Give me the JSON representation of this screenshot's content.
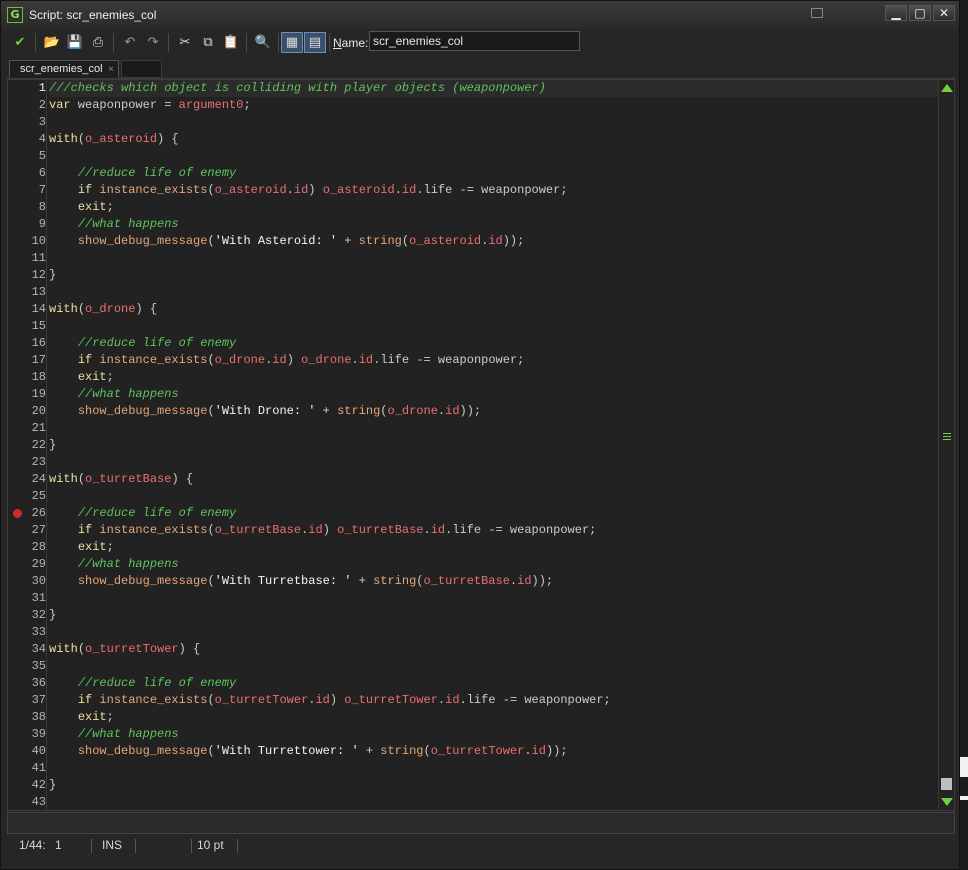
{
  "window": {
    "title": "Script: scr_enemies_col"
  },
  "titlebar": {
    "minimize": "▁",
    "maximize": "□",
    "close": "✕"
  },
  "toolbar": {
    "buttons": [
      {
        "icon": "check-icon",
        "glyph": "✔",
        "label": "OK"
      },
      {
        "icon": "open-folder-icon",
        "glyph": "📂",
        "label": "Load"
      },
      {
        "icon": "save-icon",
        "glyph": "💾",
        "label": "Save"
      },
      {
        "icon": "print-icon",
        "glyph": "⎙",
        "label": "Print"
      },
      {
        "icon": "undo-icon",
        "glyph": "↶",
        "label": "Undo"
      },
      {
        "icon": "redo-icon",
        "glyph": "↷",
        "label": "Redo"
      },
      {
        "icon": "cut-icon",
        "glyph": "✂",
        "label": "Cut"
      },
      {
        "icon": "copy-icon",
        "glyph": "⧉",
        "label": "Copy"
      },
      {
        "icon": "paste-icon",
        "glyph": "📋",
        "label": "Paste"
      },
      {
        "icon": "find-icon",
        "glyph": "🔍",
        "label": "Find"
      },
      {
        "icon": "code-toggle-icon",
        "glyph": "▦",
        "label": "Toggle"
      },
      {
        "icon": "script-run-icon",
        "glyph": "▤",
        "label": "Script"
      }
    ],
    "name_label_first": "N",
    "name_label_rest": "ame:",
    "name_value": "scr_enemies_col"
  },
  "tabs": [
    {
      "label": "scr_enemies_col",
      "close": "×"
    }
  ],
  "gutter": {
    "breakpoint_line": 26,
    "line_count": 43
  },
  "code_lines": [
    [
      [
        "c",
        "///checks which object is colliding with player objects (weaponpower)"
      ]
    ],
    [
      [
        "k",
        "var"
      ],
      [
        "p",
        " weaponpower = "
      ],
      [
        "o",
        "argument0"
      ],
      [
        "p",
        ";"
      ]
    ],
    [],
    [
      [
        "k",
        "with"
      ],
      [
        "p",
        "("
      ],
      [
        "o",
        "o_asteroid"
      ],
      [
        "p",
        ") {"
      ]
    ],
    [],
    [
      [
        "p",
        "    "
      ],
      [
        "c",
        "//reduce life of enemy"
      ]
    ],
    [
      [
        "p",
        "    "
      ],
      [
        "k",
        "if"
      ],
      [
        "p",
        " "
      ],
      [
        "f",
        "instance_exists"
      ],
      [
        "p",
        "("
      ],
      [
        "o",
        "o_asteroid"
      ],
      [
        "p",
        "."
      ],
      [
        "o",
        "id"
      ],
      [
        "p",
        ") "
      ],
      [
        "o",
        "o_asteroid"
      ],
      [
        "p",
        "."
      ],
      [
        "o",
        "id"
      ],
      [
        "p",
        ".life -= weaponpower;"
      ]
    ],
    [
      [
        "p",
        "    "
      ],
      [
        "k",
        "exit"
      ],
      [
        "p",
        ";"
      ]
    ],
    [
      [
        "p",
        "    "
      ],
      [
        "c",
        "//what happens"
      ]
    ],
    [
      [
        "p",
        "    "
      ],
      [
        "f",
        "show_debug_message"
      ],
      [
        "p",
        "("
      ],
      [
        "s",
        "'With Asteroid: '"
      ],
      [
        "p",
        " + "
      ],
      [
        "f",
        "string"
      ],
      [
        "p",
        "("
      ],
      [
        "o",
        "o_asteroid"
      ],
      [
        "p",
        "."
      ],
      [
        "o",
        "id"
      ],
      [
        "p",
        "));"
      ]
    ],
    [],
    [
      [
        "p",
        "}"
      ]
    ],
    [],
    [
      [
        "k",
        "with"
      ],
      [
        "p",
        "("
      ],
      [
        "o",
        "o_drone"
      ],
      [
        "p",
        ") {"
      ]
    ],
    [],
    [
      [
        "p",
        "    "
      ],
      [
        "c",
        "//reduce life of enemy"
      ]
    ],
    [
      [
        "p",
        "    "
      ],
      [
        "k",
        "if"
      ],
      [
        "p",
        " "
      ],
      [
        "f",
        "instance_exists"
      ],
      [
        "p",
        "("
      ],
      [
        "o",
        "o_drone"
      ],
      [
        "p",
        "."
      ],
      [
        "o",
        "id"
      ],
      [
        "p",
        ") "
      ],
      [
        "o",
        "o_drone"
      ],
      [
        "p",
        "."
      ],
      [
        "o",
        "id"
      ],
      [
        "p",
        ".life -= weaponpower;"
      ]
    ],
    [
      [
        "p",
        "    "
      ],
      [
        "k",
        "exit"
      ],
      [
        "p",
        ";"
      ]
    ],
    [
      [
        "p",
        "    "
      ],
      [
        "c",
        "//what happens"
      ]
    ],
    [
      [
        "p",
        "    "
      ],
      [
        "f",
        "show_debug_message"
      ],
      [
        "p",
        "("
      ],
      [
        "s",
        "'With Drone: '"
      ],
      [
        "p",
        " + "
      ],
      [
        "f",
        "string"
      ],
      [
        "p",
        "("
      ],
      [
        "o",
        "o_drone"
      ],
      [
        "p",
        "."
      ],
      [
        "o",
        "id"
      ],
      [
        "p",
        "));"
      ]
    ],
    [],
    [
      [
        "p",
        "}"
      ]
    ],
    [],
    [
      [
        "k",
        "with"
      ],
      [
        "p",
        "("
      ],
      [
        "o",
        "o_turretBase"
      ],
      [
        "p",
        ") {"
      ]
    ],
    [],
    [
      [
        "p",
        "    "
      ],
      [
        "c",
        "//reduce life of enemy"
      ]
    ],
    [
      [
        "p",
        "    "
      ],
      [
        "k",
        "if"
      ],
      [
        "p",
        " "
      ],
      [
        "f",
        "instance_exists"
      ],
      [
        "p",
        "("
      ],
      [
        "o",
        "o_turretBase"
      ],
      [
        "p",
        "."
      ],
      [
        "o",
        "id"
      ],
      [
        "p",
        ") "
      ],
      [
        "o",
        "o_turretBase"
      ],
      [
        "p",
        "."
      ],
      [
        "o",
        "id"
      ],
      [
        "p",
        ".life -= weaponpower;"
      ]
    ],
    [
      [
        "p",
        "    "
      ],
      [
        "k",
        "exit"
      ],
      [
        "p",
        ";"
      ]
    ],
    [
      [
        "p",
        "    "
      ],
      [
        "c",
        "//what happens"
      ]
    ],
    [
      [
        "p",
        "    "
      ],
      [
        "f",
        "show_debug_message"
      ],
      [
        "p",
        "("
      ],
      [
        "s",
        "'With Turretbase: '"
      ],
      [
        "p",
        " + "
      ],
      [
        "f",
        "string"
      ],
      [
        "p",
        "("
      ],
      [
        "o",
        "o_turretBase"
      ],
      [
        "p",
        "."
      ],
      [
        "o",
        "id"
      ],
      [
        "p",
        "));"
      ]
    ],
    [],
    [
      [
        "p",
        "}"
      ]
    ],
    [],
    [
      [
        "k",
        "with"
      ],
      [
        "p",
        "("
      ],
      [
        "o",
        "o_turretTower"
      ],
      [
        "p",
        ") {"
      ]
    ],
    [],
    [
      [
        "p",
        "    "
      ],
      [
        "c",
        "//reduce life of enemy"
      ]
    ],
    [
      [
        "p",
        "    "
      ],
      [
        "k",
        "if"
      ],
      [
        "p",
        " "
      ],
      [
        "f",
        "instance_exists"
      ],
      [
        "p",
        "("
      ],
      [
        "o",
        "o_turretTower"
      ],
      [
        "p",
        "."
      ],
      [
        "o",
        "id"
      ],
      [
        "p",
        ") "
      ],
      [
        "o",
        "o_turretTower"
      ],
      [
        "p",
        "."
      ],
      [
        "o",
        "id"
      ],
      [
        "p",
        ".life -= weaponpower;"
      ]
    ],
    [
      [
        "p",
        "    "
      ],
      [
        "k",
        "exit"
      ],
      [
        "p",
        ";"
      ]
    ],
    [
      [
        "p",
        "    "
      ],
      [
        "c",
        "//what happens"
      ]
    ],
    [
      [
        "p",
        "    "
      ],
      [
        "f",
        "show_debug_message"
      ],
      [
        "p",
        "("
      ],
      [
        "s",
        "'With Turrettower: '"
      ],
      [
        "p",
        " + "
      ],
      [
        "f",
        "string"
      ],
      [
        "p",
        "("
      ],
      [
        "o",
        "o_turretTower"
      ],
      [
        "p",
        "."
      ],
      [
        "o",
        "id"
      ],
      [
        "p",
        "));"
      ]
    ],
    [],
    [
      [
        "p",
        "}"
      ]
    ],
    []
  ],
  "status": {
    "position": "1/44:",
    "column": "1",
    "mode": "INS",
    "empty": "",
    "font_size": "10 pt"
  },
  "colors": {
    "accent": "#6fd23c",
    "comment": "#5ec45e",
    "keyword": "#ece0a0",
    "function": "#e6a67a",
    "object": "#ec6e6e",
    "breakpoint": "#d12a2a"
  }
}
